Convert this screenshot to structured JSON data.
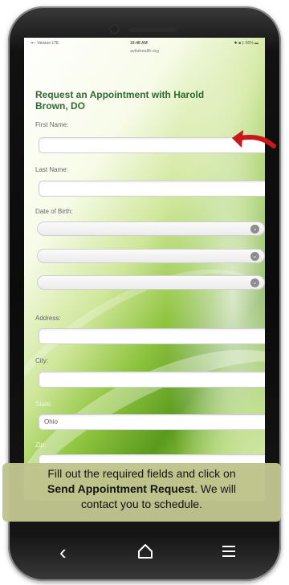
{
  "status_bar": {
    "carrier": "••◦◦ Verizon LTE",
    "time": "10:48 AM",
    "battery": "✱ ■ ‡ 66% ▬"
  },
  "url": "avilahealth.org",
  "form": {
    "title": "Request an Appointment with Harold Brown, DO",
    "first_name_label": "First Name:",
    "last_name_label": "Last Name:",
    "dob_label": "Date of Birth:",
    "address_label": "Address:",
    "city_label": "City:",
    "state_label": "State:",
    "state_value": "Ohio",
    "zip_label": "Zip:"
  },
  "caption": {
    "line1": "Fill out the required fields and click on",
    "bold": "Send Appointment Request",
    "line2_rest": ". We will",
    "line3": "contact you to schedule."
  },
  "icons": {
    "back": "chevron-left-icon",
    "home": "home-icon",
    "menu": "menu-icon",
    "select_chevron": "chevron-down-icon",
    "pointer": "red-arrow-icon"
  },
  "colors": {
    "title": "#2f6a33",
    "arrow": "#c8171d",
    "caption_bg": "#c0c48e"
  }
}
